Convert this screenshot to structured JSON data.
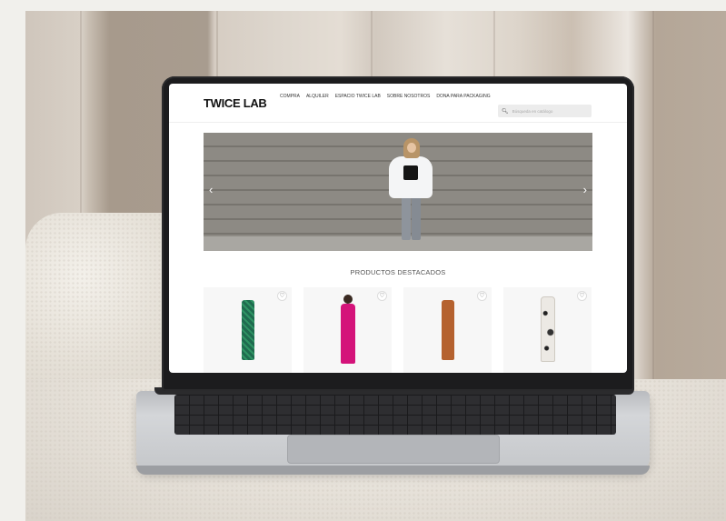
{
  "site": {
    "logo": "TWICE LAB",
    "menu": [
      "COMPRA",
      "ALQUILER",
      "ESPACIO TWICE LAB",
      "SOBRE NOSOTROS",
      "DONA PARA PACKAGING"
    ],
    "search_placeholder": "Búsqueda en catálogo",
    "search_icon": "search-icon",
    "hero": {
      "prev": "‹",
      "next": "›"
    },
    "section_title": "PRODUCTOS DESTACADOS",
    "favorite_icon": "♡",
    "products": [
      {
        "name": "green-print-slip-dress",
        "color": "#1f6b4f",
        "accent": "#2a8a5e"
      },
      {
        "name": "pink-off-shoulder-dress",
        "color": "#d4137a",
        "accent": "#b30f66"
      },
      {
        "name": "rust-slip-dress",
        "color": "#b5622f",
        "accent": "#9c5226"
      },
      {
        "name": "black-white-print-dress",
        "color": "#ece9e4",
        "accent": "#2a2a2a"
      }
    ]
  }
}
